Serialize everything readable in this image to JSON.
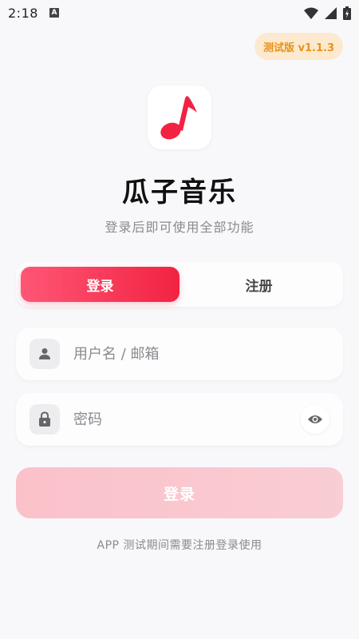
{
  "status_bar": {
    "time": "2:18",
    "notification_icon": "a-icon"
  },
  "version_badge": "测试版 v1.1.3",
  "app": {
    "title": "瓜子音乐",
    "subtitle": "登录后即可使用全部功能"
  },
  "tabs": [
    {
      "label": "登录",
      "active": true
    },
    {
      "label": "注册",
      "active": false
    }
  ],
  "form": {
    "username": {
      "placeholder": "用户名 / 邮箱",
      "value": "",
      "icon": "person-icon"
    },
    "password": {
      "placeholder": "密码",
      "value": "",
      "icon": "lock-icon",
      "toggle_icon": "eye-icon"
    }
  },
  "login_button": "登录",
  "footer_note": "APP 测试期间需要注册登录使用",
  "colors": {
    "accent": "#f22342",
    "badge_bg": "#fde9cf",
    "badge_text": "#e8931a",
    "button_disabled": "#fbc4cd"
  }
}
